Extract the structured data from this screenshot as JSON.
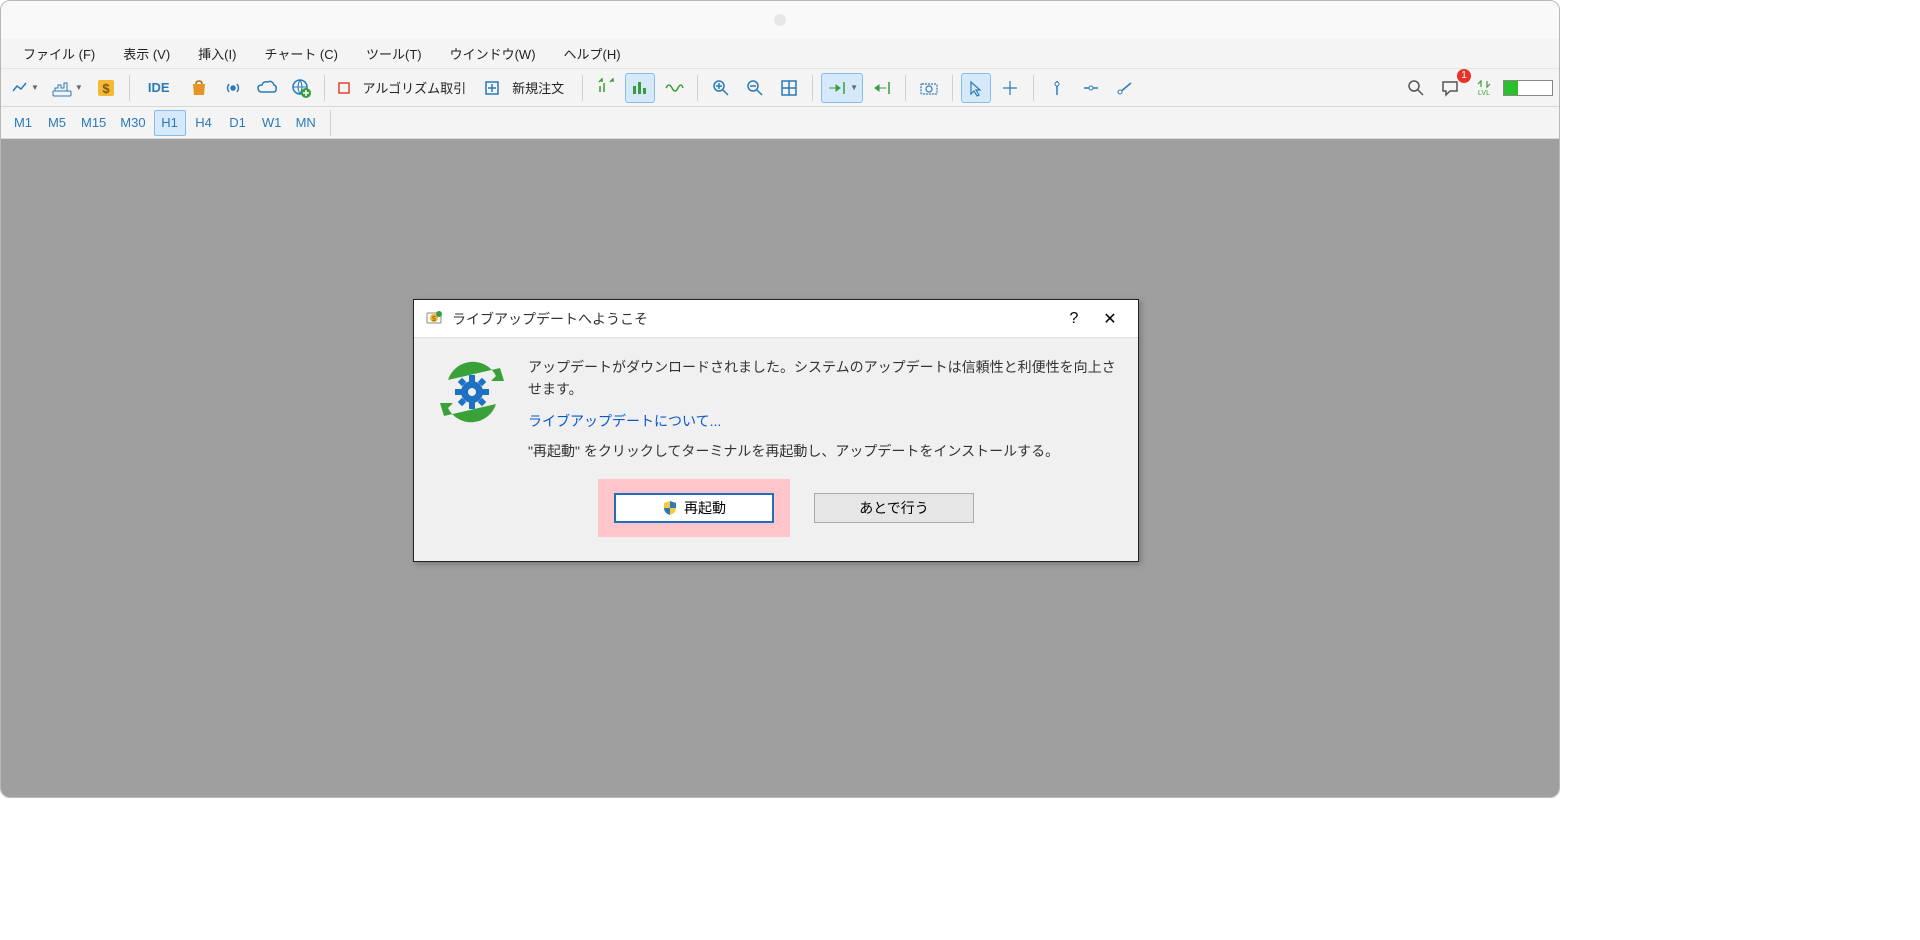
{
  "menu": {
    "file": "ファイル (F)",
    "view": "表示 (V)",
    "insert": "挿入(I)",
    "chart": "チャート (C)",
    "tools": "ツール(T)",
    "window": "ウインドウ(W)",
    "help": "ヘルプ(H)"
  },
  "toolbar": {
    "ide": "IDE",
    "algo_trade": "アルゴリズム取引",
    "new_order": "新規注文",
    "lvl": "LVL",
    "notif_count": "1"
  },
  "timeframes": {
    "m1": "M1",
    "m5": "M5",
    "m15": "M15",
    "m30": "M30",
    "h1": "H1",
    "h4": "H4",
    "d1": "D1",
    "w1": "W1",
    "mn": "MN"
  },
  "dialog": {
    "title": "ライブアップデートへようこそ",
    "help_symbol": "?",
    "close_symbol": "✕",
    "message": "アップデートがダウンロードされました。システムのアップデートは信頼性と利便性を向上させます。",
    "link": "ライブアップデートについて...",
    "instruction": "\"再起動\" をクリックしてターミナルを再起動し、アップデートをインストールする。",
    "restart_label": "再起動",
    "later_label": "あとで行う"
  }
}
